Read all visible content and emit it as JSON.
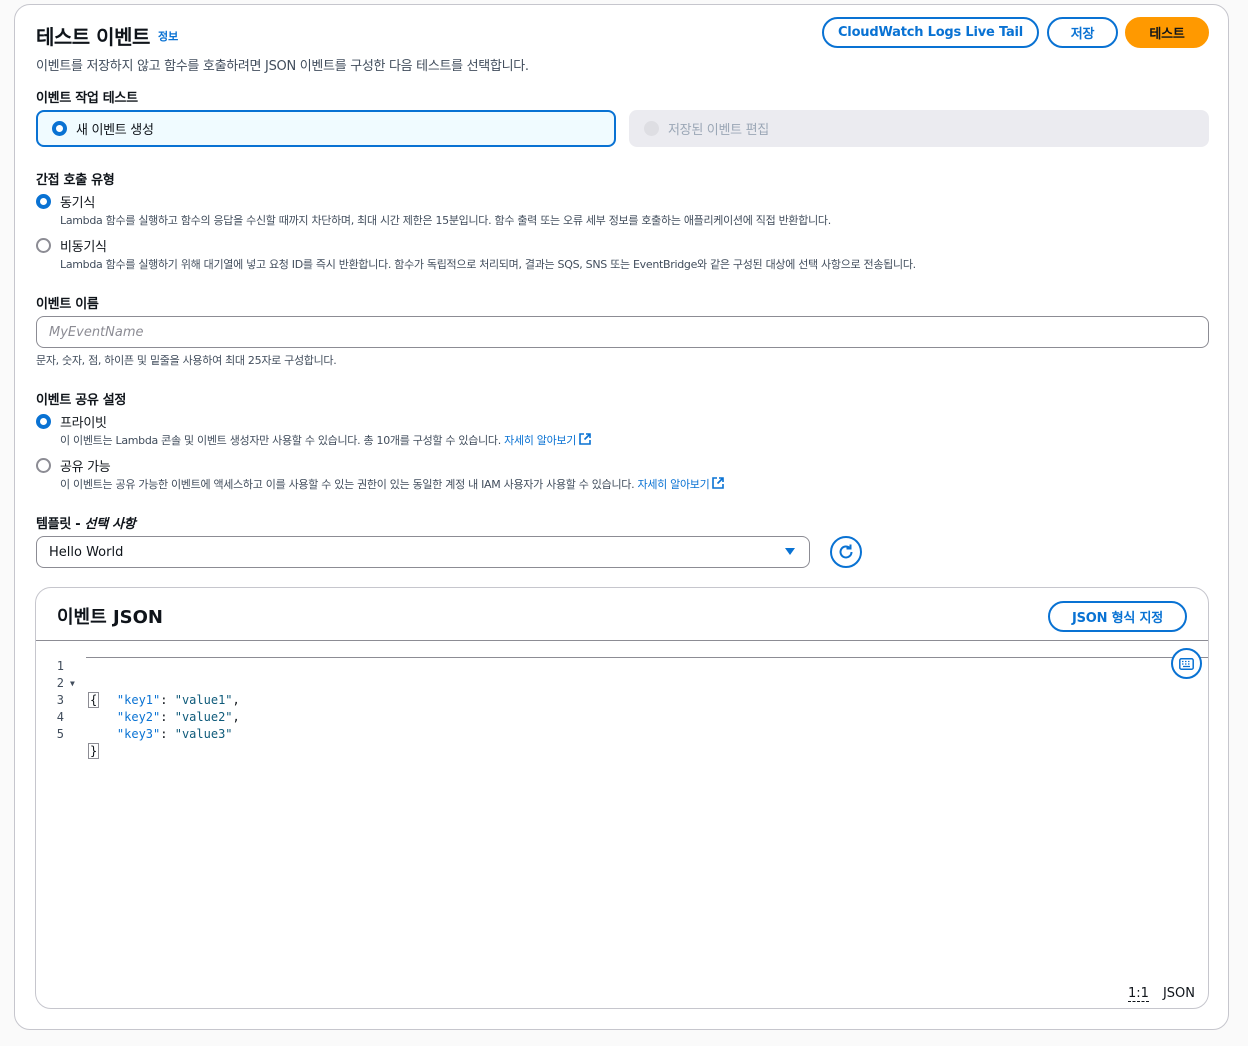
{
  "header": {
    "title": "테스트 이벤트",
    "info_link": "정보",
    "subtitle": "이벤트를 저장하지 않고 함수를 호출하려면 JSON 이벤트를 구성한 다음 테스트를 선택합니다.",
    "buttons": {
      "live_tail": "CloudWatch Logs Live Tail",
      "save": "저장",
      "test": "테스트"
    }
  },
  "test_action": {
    "label": "이벤트 작업 테스트",
    "options": [
      {
        "label": "새 이벤트 생성",
        "selected": true,
        "disabled": false
      },
      {
        "label": "저장된 이벤트 편집",
        "selected": false,
        "disabled": true
      }
    ]
  },
  "invocation_type": {
    "label": "간접 호출 유형",
    "options": [
      {
        "title": "동기식",
        "desc": "Lambda 함수를 실행하고 함수의 응답을 수신할 때까지 차단하며, 최대 시간 제한은 15분입니다. 함수 출력 또는 오류 세부 정보를 호출하는 애플리케이션에 직접 반환합니다.",
        "selected": true
      },
      {
        "title": "비동기식",
        "desc": "Lambda 함수를 실행하기 위해 대기열에 넣고 요청 ID를 즉시 반환합니다. 함수가 독립적으로 처리되며, 결과는 SQS, SNS 또는 EventBridge와 같은 구성된 대상에 선택 사항으로 전송됩니다.",
        "selected": false
      }
    ]
  },
  "event_name": {
    "label": "이벤트 이름",
    "placeholder": "MyEventName",
    "value": "",
    "hint": "문자, 숫자, 점, 하이픈 및 밑줄을 사용하여 최대 25자로 구성합니다."
  },
  "sharing": {
    "label": "이벤트 공유 설정",
    "options": [
      {
        "title": "프라이빗",
        "desc": "이 이벤트는 Lambda 콘솔 및 이벤트 생성자만 사용할 수 있습니다. 총 10개를 구성할 수 있습니다.",
        "link": "자세히 알아보기",
        "selected": true
      },
      {
        "title": "공유 가능",
        "desc": "이 이벤트는 공유 가능한 이벤트에 액세스하고 이를 사용할 수 있는 권한이 있는 동일한 계정 내 IAM 사용자가 사용할 수 있습니다.",
        "link": "자세히 알아보기",
        "selected": false
      }
    ]
  },
  "template": {
    "label": "템플릿 - ",
    "label_optional": "선택 사항",
    "selected": "Hello World",
    "refresh_icon": "refresh-icon"
  },
  "editor": {
    "title": "이벤트 JSON",
    "format_button": "JSON 형식 지정",
    "keyboard_icon": "keyboard-icon",
    "lines": [
      {
        "n": "1",
        "text": "{"
      },
      {
        "n": "2",
        "key": "\"key1\"",
        "val": "\"value1\"",
        "comma": ","
      },
      {
        "n": "3",
        "key": "\"key2\"",
        "val": "\"value2\"",
        "comma": ","
      },
      {
        "n": "4",
        "key": "\"key3\"",
        "val": "\"value3\"",
        "comma": ""
      },
      {
        "n": "5",
        "text": "}"
      }
    ],
    "status": {
      "position": "1:1",
      "language": "JSON"
    }
  },
  "colors": {
    "accent": "#0972d3",
    "primary_button": "#ff9900"
  }
}
